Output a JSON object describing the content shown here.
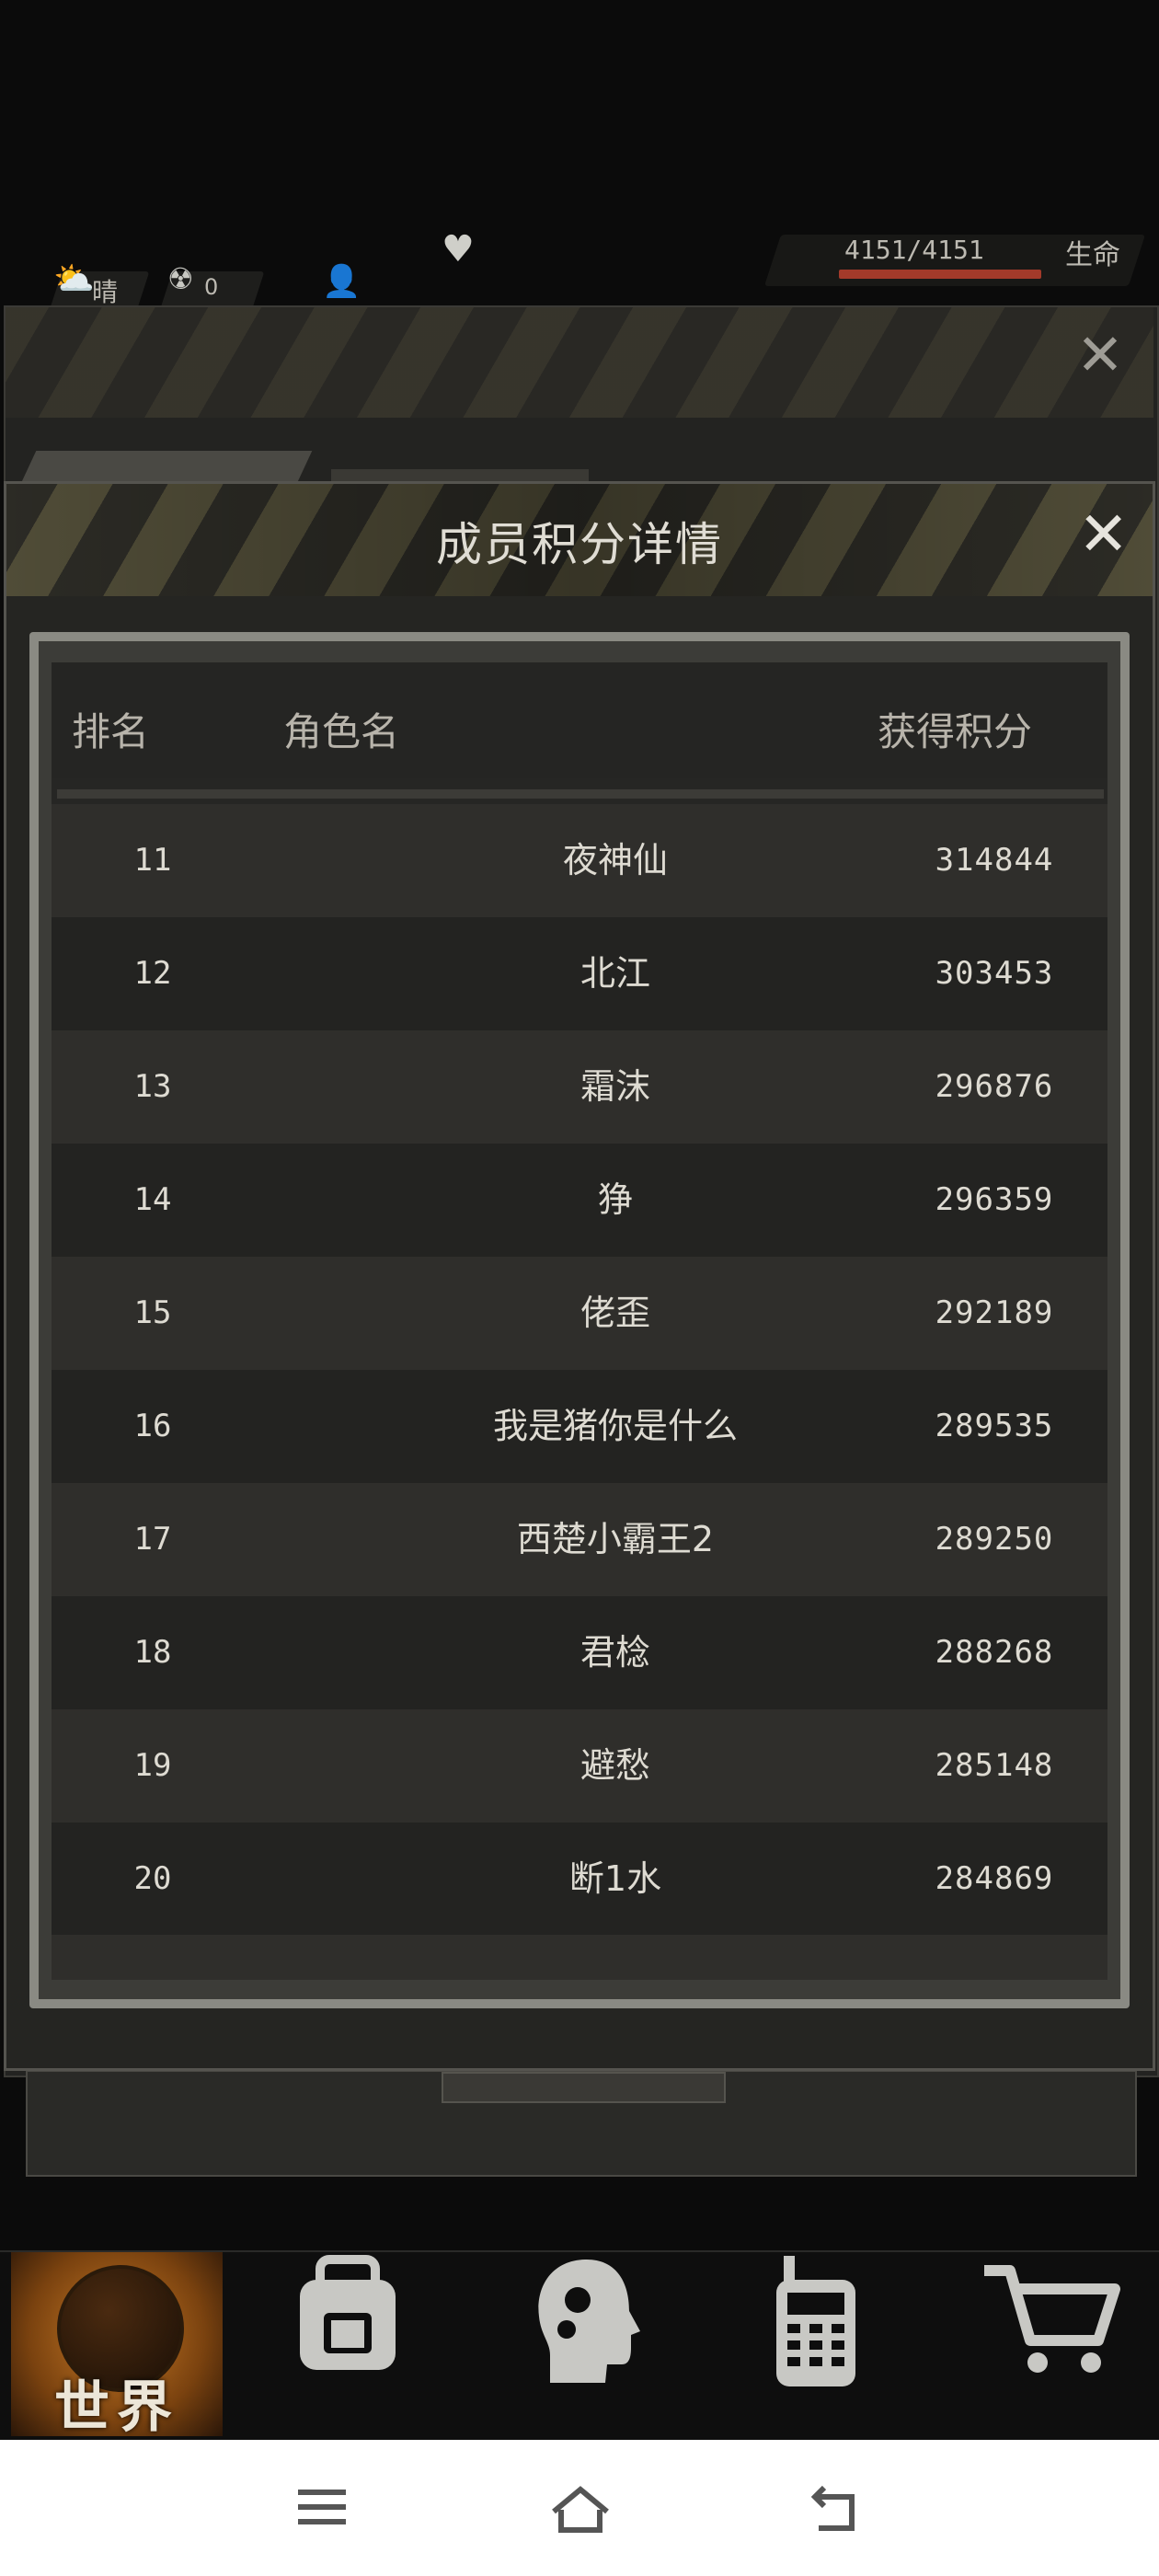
{
  "status": {
    "weather_label": "晴",
    "radiation_value": "0",
    "health_text": "4151/4151",
    "life_label": "生命",
    "health_fraction": 1.0
  },
  "modal": {
    "title": "成员积分详情",
    "columns": [
      "排名",
      "角色名",
      "获得积分"
    ],
    "rows": [
      {
        "rank": "11",
        "name": "夜神仙",
        "score": "314844"
      },
      {
        "rank": "12",
        "name": "北江",
        "score": "303453"
      },
      {
        "rank": "13",
        "name": "霜沫",
        "score": "296876"
      },
      {
        "rank": "14",
        "name": "狰",
        "score": "296359"
      },
      {
        "rank": "15",
        "name": "佬歪",
        "score": "292189"
      },
      {
        "rank": "16",
        "name": "我是猪你是什么",
        "score": "289535"
      },
      {
        "rank": "17",
        "name": "西楚小霸王2",
        "score": "289250"
      },
      {
        "rank": "18",
        "name": "君棯",
        "score": "288268"
      },
      {
        "rank": "19",
        "name": "避愁",
        "score": "285148"
      },
      {
        "rank": "20",
        "name": "断1水",
        "score": "284869"
      }
    ]
  },
  "game_nav": {
    "world_label": "世界",
    "items": [
      "world-icon",
      "backpack-icon",
      "skills-head-icon",
      "radio-icon",
      "shop-cart-icon"
    ]
  },
  "system_nav": [
    "menu-icon",
    "home-icon",
    "back-icon"
  ],
  "colors": {
    "accent_orange": "#c87a26",
    "health_red": "#a33a2a",
    "panel_dark": "#252522"
  }
}
